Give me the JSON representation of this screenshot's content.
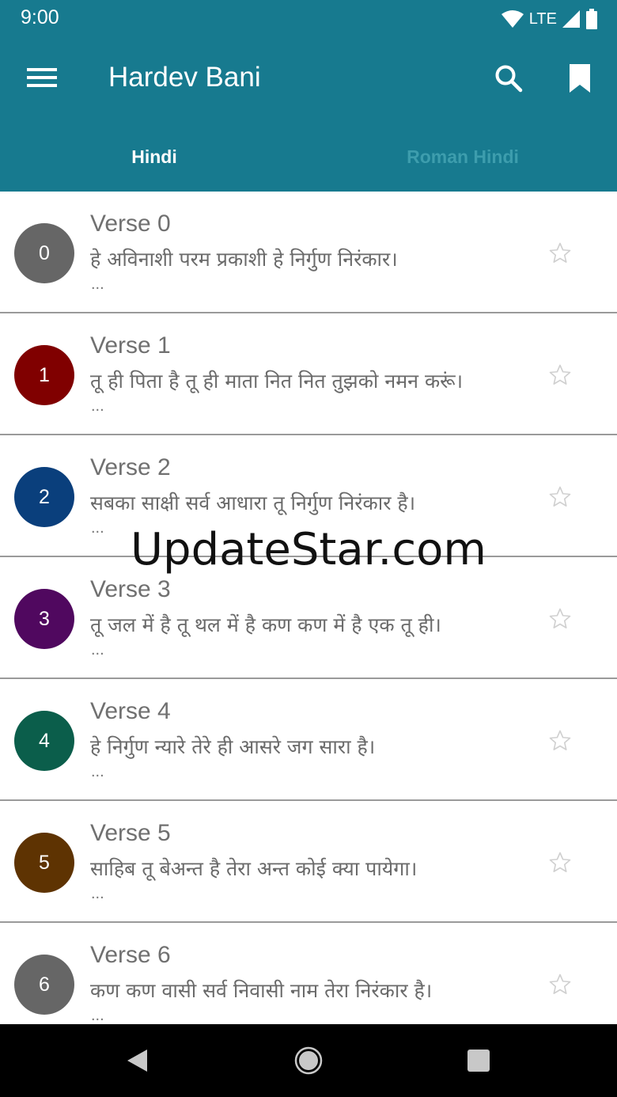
{
  "status": {
    "time": "9:00",
    "network": "LTE"
  },
  "app": {
    "title": "Hardev Bani"
  },
  "tabs": [
    {
      "label": "Hindi",
      "active": true
    },
    {
      "label": "Roman Hindi",
      "active": false
    }
  ],
  "verses": [
    {
      "number": "0",
      "title": "Verse 0",
      "text": "हे अविनाशी परम प्रकाशी हे निर्गुण निरंकार।",
      "more": "...",
      "color": "#666666"
    },
    {
      "number": "1",
      "title": "Verse 1",
      "text": "तू ही पिता है तू ही माता नित नित तुझको नमन करूं।",
      "more": "...",
      "color": "#800000"
    },
    {
      "number": "2",
      "title": "Verse 2",
      "text": "सबका साक्षी सर्व आधारा तू निर्गुण निरंकार है।",
      "more": "...",
      "color": "#0a3f7c"
    },
    {
      "number": "3",
      "title": "Verse 3",
      "text": "तू जल में है तू थल में है कण कण में है एक तू ही।",
      "more": "...",
      "color": "#50085f"
    },
    {
      "number": "4",
      "title": "Verse 4",
      "text": "हे निर्गुण न्यारे तेरे ही आसरे जग सारा है।",
      "more": "...",
      "color": "#0b5e4b"
    },
    {
      "number": "5",
      "title": "Verse 5",
      "text": "साहिब तू बेअन्त है तेरा अन्त कोई क्या पायेगा।",
      "more": "...",
      "color": "#5e3302"
    },
    {
      "number": "6",
      "title": "Verse 6",
      "text": "कण कण वासी सर्व निवासी नाम तेरा निरंकार है।",
      "more": "...",
      "color": "#666666"
    }
  ],
  "watermark": "UpdateStar.com",
  "icons": {
    "menu": "menu-icon",
    "search": "search-icon",
    "bookmark": "bookmark-icon",
    "favorite": "star-outline-icon",
    "back": "back-triangle-icon",
    "home": "home-circle-icon",
    "recents": "recents-square-icon"
  },
  "colors": {
    "appbar": "#177a8f",
    "tab_active": "#ffffff",
    "tab_inactive": "#3d9dad",
    "nav_bar": "#000000"
  }
}
